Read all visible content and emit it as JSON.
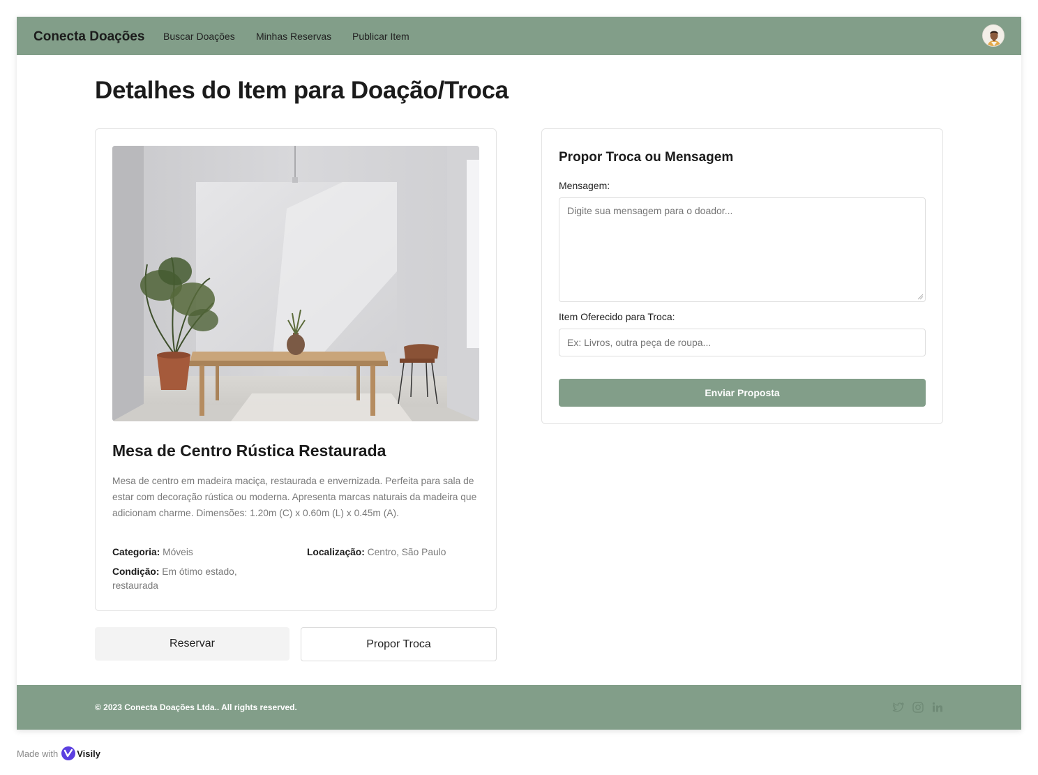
{
  "navbar": {
    "brand": "Conecta Doações",
    "links": [
      {
        "label": "Buscar Doações"
      },
      {
        "label": "Minhas Reservas"
      },
      {
        "label": "Publicar Item"
      }
    ],
    "background": "#829e89"
  },
  "page": {
    "title": "Detalhes do Item para Doação/Troca"
  },
  "item": {
    "title": "Mesa de Centro Rústica Restaurada",
    "description": "Mesa de centro em madeira maciça, restaurada e envernizada. Perfeita para sala de estar com decoração rústica ou moderna. Apresenta marcas naturais da madeira que adicionam charme. Dimensões: 1.20m (C) x 0.60m (L) x 0.45m (A).",
    "category_label": "Categoria:",
    "category_value": "Móveis",
    "location_label": "Localização:",
    "location_value": "Centro, São Paulo",
    "condition_label": "Condição:",
    "condition_value": "Em ótimo estado, restaurada"
  },
  "actions": {
    "reserve_label": "Reservar",
    "trade_label": "Propor Troca"
  },
  "form": {
    "title": "Propor Troca ou Mensagem",
    "message_label": "Mensagem:",
    "message_placeholder": "Digite sua mensagem para o doador...",
    "offer_label": "Item Oferecido para Troca:",
    "offer_placeholder": "Ex: Livros, outra peça de roupa...",
    "submit_label": "Enviar Proposta"
  },
  "footer": {
    "copyright": "© 2023 Conecta Doações Ltda.. All rights reserved.",
    "social_icons": [
      "twitter-icon",
      "instagram-icon",
      "linkedin-icon"
    ]
  },
  "badge": {
    "made_with": "Made with",
    "brand": "Visily"
  },
  "colors": {
    "accent": "#829e89",
    "muted_text": "#7a7a7a"
  }
}
